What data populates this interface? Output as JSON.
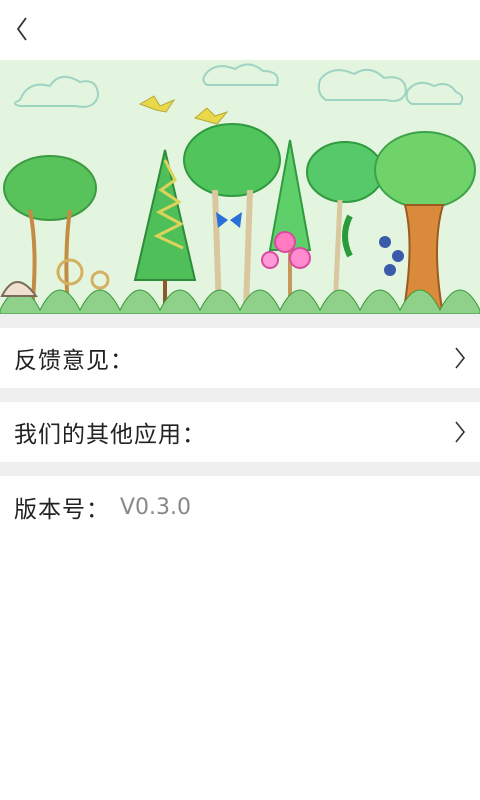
{
  "header": {
    "back_icon": "chevron-left-icon"
  },
  "banner": {
    "illustration": "hand-drawn forest of trees with flowers, butterflies and birds"
  },
  "settings": {
    "feedback_label": "反馈意见：",
    "other_apps_label": "我们的其他应用：",
    "version_label": "版本号：",
    "version_value": "V0.3.0",
    "chevron_icon": "chevron-right-icon"
  },
  "colors": {
    "background": "#ffffff",
    "divider": "#efefef",
    "banner_background": "#e6f7e6",
    "label_text": "#222222",
    "value_text": "#888888"
  }
}
